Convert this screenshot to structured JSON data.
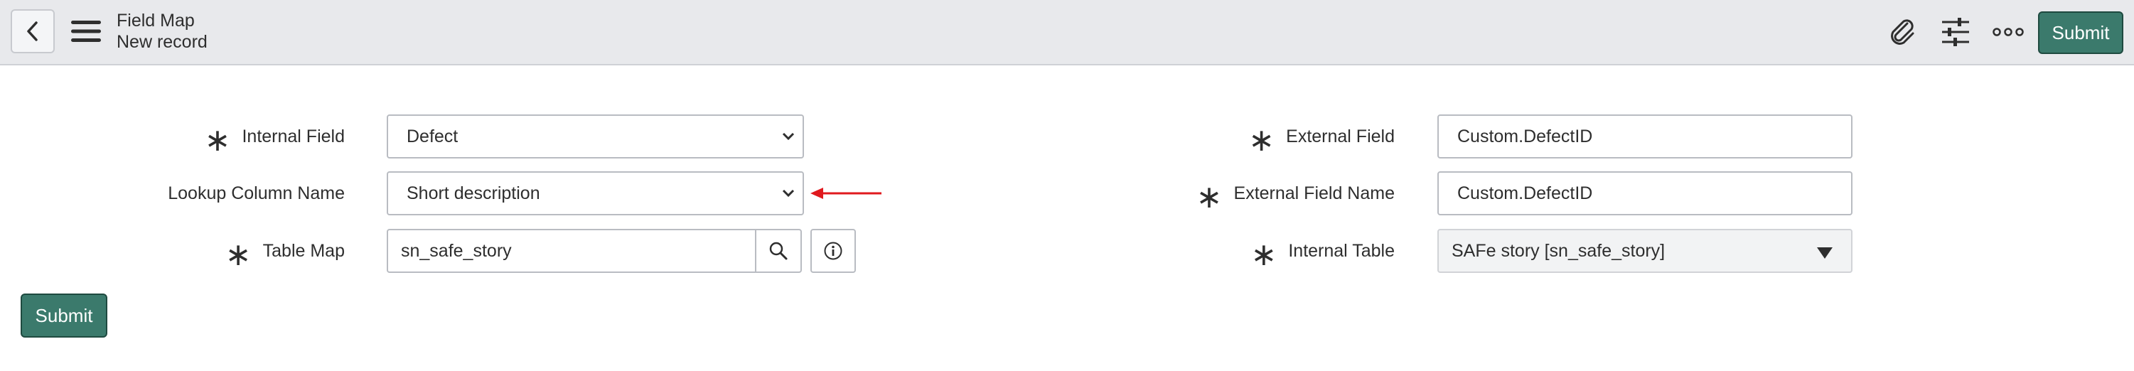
{
  "header": {
    "title": "Field Map",
    "subtitle": "New record",
    "submit_label": "Submit",
    "icons": [
      "back-icon",
      "menu-icon",
      "paperclip-icon",
      "sliders-icon",
      "more-icon"
    ]
  },
  "form": {
    "internal_field": {
      "label": "Internal Field",
      "value": "Defect",
      "required": true
    },
    "lookup_column": {
      "label": "Lookup Column Name",
      "value": "Short description",
      "required": false
    },
    "table_map": {
      "label": "Table Map",
      "value": "sn_safe_story",
      "required": true
    },
    "external_field": {
      "label": "External Field",
      "value": "Custom.DefectID",
      "required": true
    },
    "external_field_name": {
      "label": "External Field Name",
      "value": "Custom.DefectID",
      "required": true
    },
    "internal_table": {
      "label": "Internal Table",
      "value": "SAFe story [sn_safe_story]",
      "required": true
    }
  },
  "footer": {
    "submit_label": "Submit"
  },
  "colors": {
    "accent": "#3b7a6c",
    "arrow": "#e0191e",
    "header_bg": "#e8e9ec"
  }
}
